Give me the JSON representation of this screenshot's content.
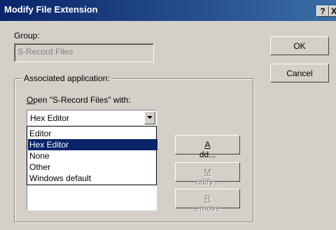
{
  "window": {
    "title": "Modify File Extension",
    "help_button": "?",
    "close_button": "X"
  },
  "group": {
    "label": "Group:",
    "value": "S-Record Files"
  },
  "buttons": {
    "ok": "OK",
    "cancel": "Cancel",
    "add_mnemonic": "A",
    "add_rest": "dd...",
    "modify_mnemonic": "M",
    "modify_rest": "odify...",
    "remove_mnemonic": "R",
    "remove_rest": "emove"
  },
  "associated": {
    "title": "Associated application:",
    "open_with_mnemonic": "O",
    "open_with_rest": "pen \"S-Record Files\" with:",
    "combo_value": "Hex Editor"
  },
  "dropdown": {
    "items": [
      {
        "label": "Editor",
        "selected": false
      },
      {
        "label": "Hex Editor",
        "selected": true
      },
      {
        "label": "None",
        "selected": false
      },
      {
        "label": "Other",
        "selected": false
      },
      {
        "label": "Windows default",
        "selected": false
      }
    ]
  },
  "colors": {
    "title_bar": "#0a246a",
    "selection": "#0a246a",
    "dialog_bg": "#d4d0c8"
  }
}
